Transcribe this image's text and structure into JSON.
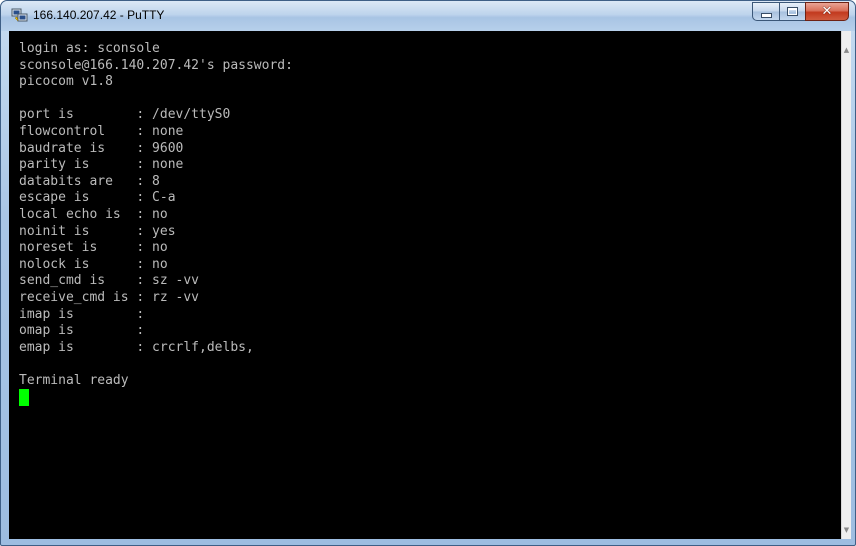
{
  "window": {
    "title": "166.140.207.42 - PuTTY",
    "app_icon": "putty-icon"
  },
  "caption_buttons": {
    "minimize_icon": "minimize-icon",
    "maximize_icon": "maximize-icon",
    "close_icon": "close-icon"
  },
  "terminal": {
    "lines": [
      "login as: sconsole",
      "sconsole@166.140.207.42's password:",
      "picocom v1.8",
      "",
      "port is        : /dev/ttyS0",
      "flowcontrol    : none",
      "baudrate is    : 9600",
      "parity is      : none",
      "databits are   : 8",
      "escape is      : C-a",
      "local echo is  : no",
      "noinit is      : yes",
      "noreset is     : no",
      "nolock is      : no",
      "send_cmd is    : sz -vv",
      "receive_cmd is : rz -vv",
      "imap is        :",
      "omap is        :",
      "emap is        : crcrlf,delbs,",
      "",
      "Terminal ready"
    ],
    "text_color": "#bbbbbb",
    "background_color": "#000000",
    "cursor_color": "#00ff00"
  }
}
